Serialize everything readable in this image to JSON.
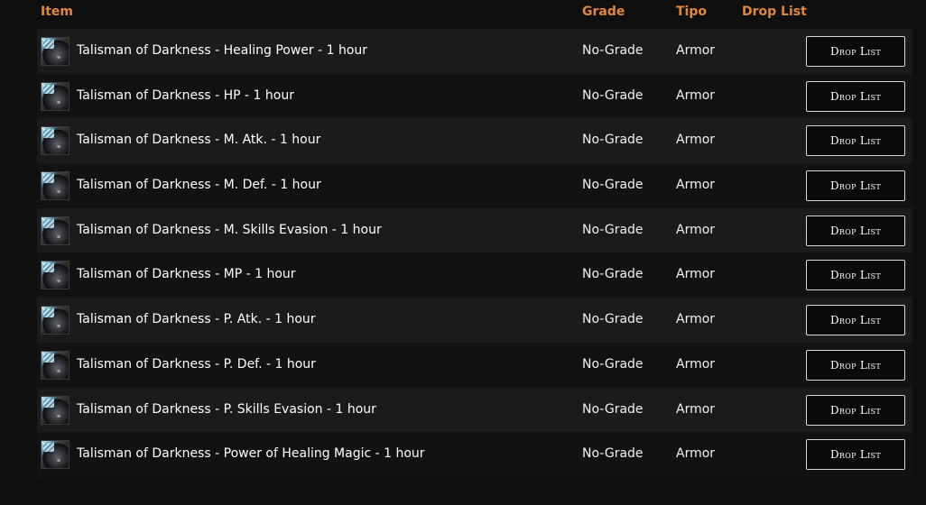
{
  "table": {
    "headers": {
      "item": "Item",
      "grade": "Grade",
      "tipo": "Tipo",
      "drop_list": "Drop List"
    },
    "rows": [
      {
        "name": "Talisman of Darkness - Healing Power - 1 hour",
        "grade": "No-Grade",
        "tipo": "Armor",
        "button": "Drop List",
        "icon": "talisman-icon"
      },
      {
        "name": "Talisman of Darkness - HP - 1 hour",
        "grade": "No-Grade",
        "tipo": "Armor",
        "button": "Drop List",
        "icon": "talisman-icon"
      },
      {
        "name": "Talisman of Darkness - M. Atk. - 1 hour",
        "grade": "No-Grade",
        "tipo": "Armor",
        "button": "Drop List",
        "icon": "talisman-icon"
      },
      {
        "name": "Talisman of Darkness - M. Def. - 1 hour",
        "grade": "No-Grade",
        "tipo": "Armor",
        "button": "Drop List",
        "icon": "talisman-icon"
      },
      {
        "name": "Talisman of Darkness - M. Skills Evasion - 1 hour",
        "grade": "No-Grade",
        "tipo": "Armor",
        "button": "Drop List",
        "icon": "talisman-icon"
      },
      {
        "name": "Talisman of Darkness - MP - 1 hour",
        "grade": "No-Grade",
        "tipo": "Armor",
        "button": "Drop List",
        "icon": "talisman-icon"
      },
      {
        "name": "Talisman of Darkness - P. Atk. - 1 hour",
        "grade": "No-Grade",
        "tipo": "Armor",
        "button": "Drop List",
        "icon": "talisman-icon"
      },
      {
        "name": "Talisman of Darkness - P. Def. - 1 hour",
        "grade": "No-Grade",
        "tipo": "Armor",
        "button": "Drop List",
        "icon": "talisman-icon"
      },
      {
        "name": "Talisman of Darkness - P. Skills Evasion - 1 hour",
        "grade": "No-Grade",
        "tipo": "Armor",
        "button": "Drop List",
        "icon": "talisman-icon"
      },
      {
        "name": "Talisman of Darkness - Power of Healing Magic - 1 hour",
        "grade": "No-Grade",
        "tipo": "Armor",
        "button": "Drop List",
        "icon": "talisman-icon"
      }
    ]
  },
  "colors": {
    "background": "#0f0f0f",
    "header_text": "#e0873a",
    "row_odd": "#1b1b1b",
    "row_even": "#121212",
    "text": "#ffffff",
    "button_border": "#d9d9d9"
  }
}
